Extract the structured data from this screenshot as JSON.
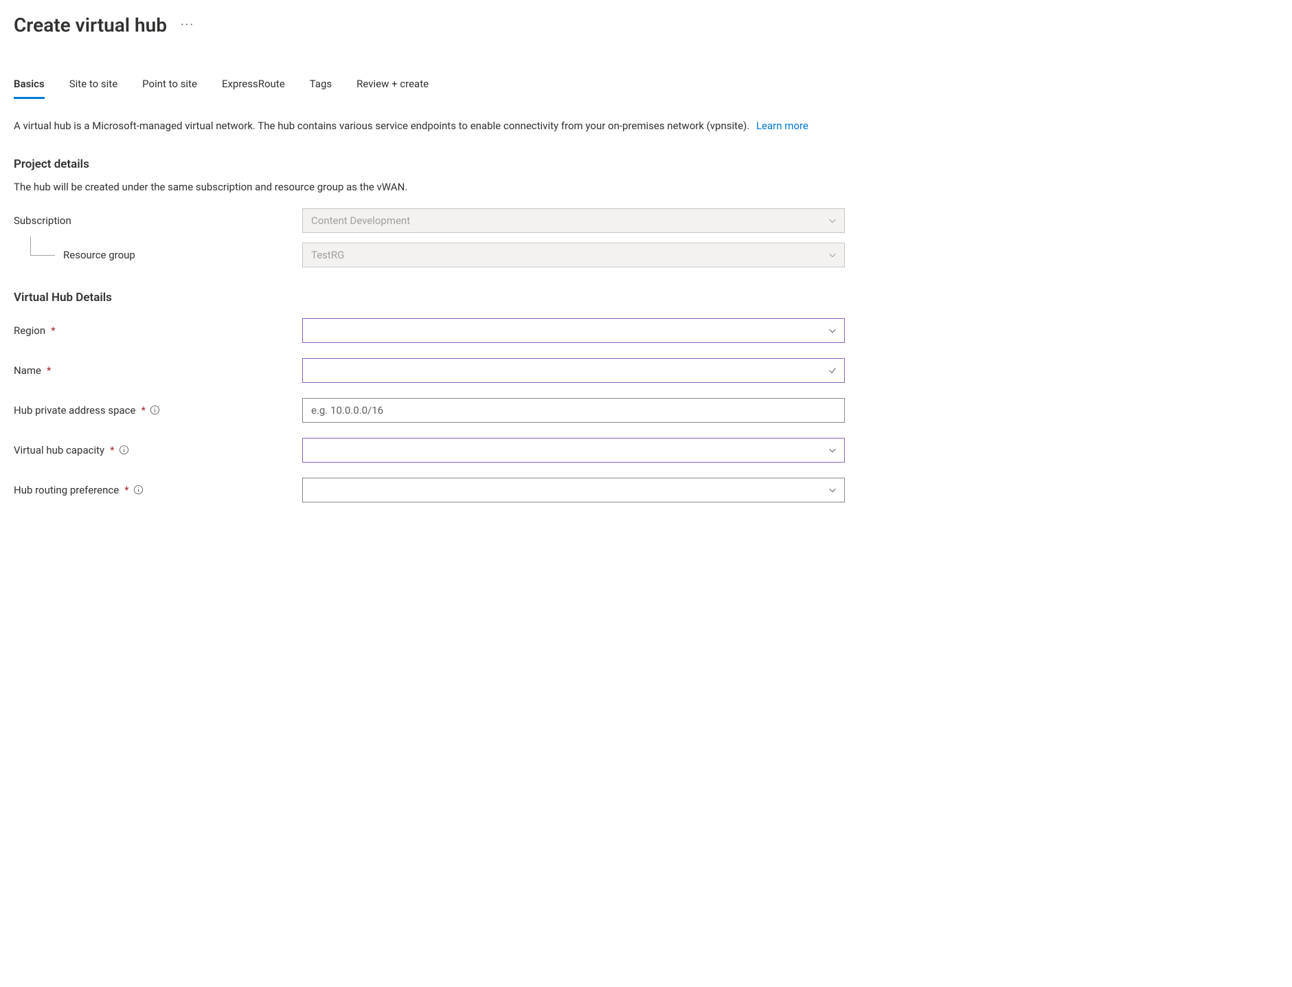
{
  "header": {
    "title": "Create virtual hub"
  },
  "tabs": [
    {
      "label": "Basics",
      "active": true
    },
    {
      "label": "Site to site",
      "active": false
    },
    {
      "label": "Point to site",
      "active": false
    },
    {
      "label": "ExpressRoute",
      "active": false
    },
    {
      "label": "Tags",
      "active": false
    },
    {
      "label": "Review + create",
      "active": false
    }
  ],
  "description": {
    "text": "A virtual hub is a Microsoft-managed virtual network. The hub contains various service endpoints to enable connectivity from your on-premises network (vpnsite).",
    "learn_more": "Learn more"
  },
  "project_details": {
    "title": "Project details",
    "subtitle": "The hub will be created under the same subscription and resource group as the vWAN.",
    "subscription": {
      "label": "Subscription",
      "value": "Content Development"
    },
    "resource_group": {
      "label": "Resource group",
      "value": "TestRG"
    }
  },
  "hub_details": {
    "title": "Virtual Hub Details",
    "region": {
      "label": "Region",
      "value": ""
    },
    "name": {
      "label": "Name",
      "value": ""
    },
    "address_space": {
      "label": "Hub private address space",
      "placeholder": "e.g. 10.0.0.0/16",
      "value": ""
    },
    "capacity": {
      "label": "Virtual hub capacity",
      "value": ""
    },
    "routing_pref": {
      "label": "Hub routing preference",
      "value": ""
    }
  }
}
